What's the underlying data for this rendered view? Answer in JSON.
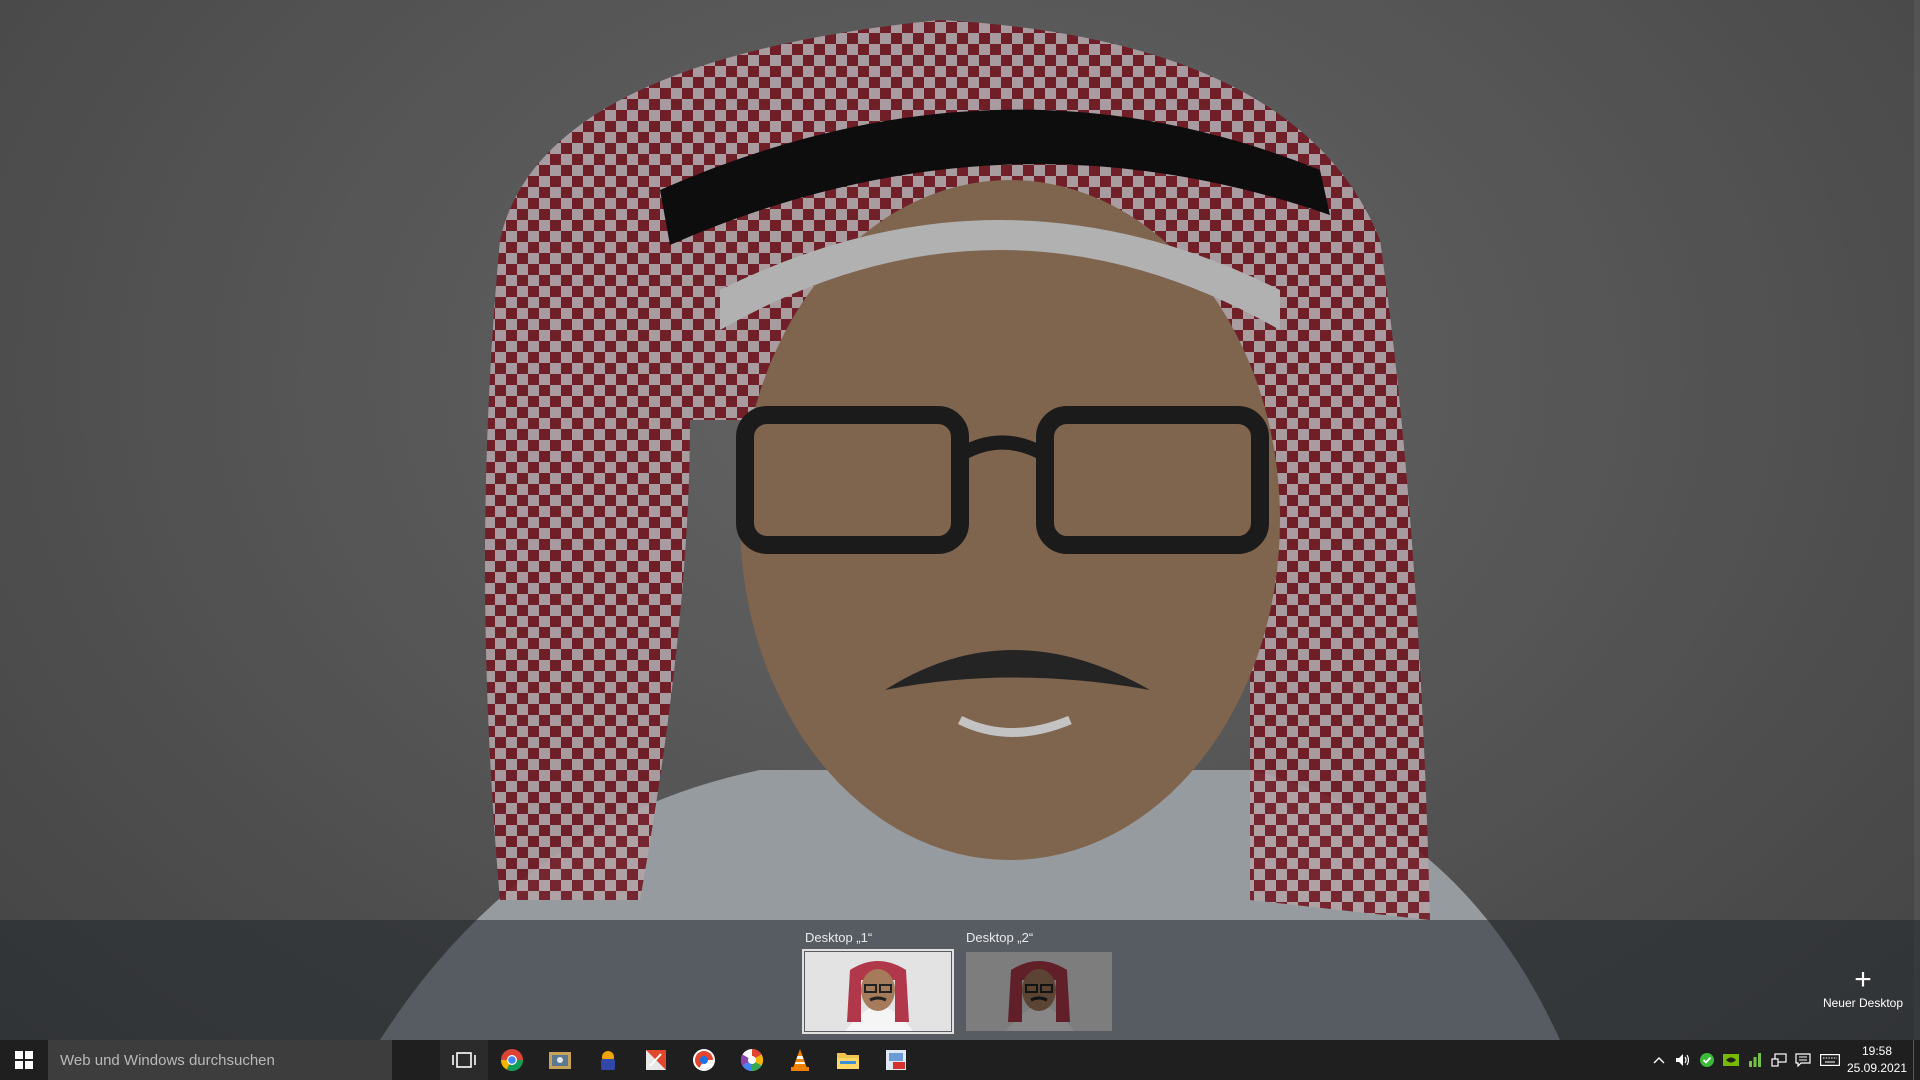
{
  "desktops": [
    {
      "label": "Desktop „1“",
      "active": true
    },
    {
      "label": "Desktop „2“",
      "active": false
    }
  ],
  "new_desktop": {
    "label": "Neuer Desktop",
    "icon": "plus-icon"
  },
  "taskbar": {
    "search_placeholder": "Web und Windows durchsuchen",
    "apps": [
      "task-view-icon",
      "chrome-icon",
      "photo-app-icon",
      "vpn-app-icon",
      "office-app-icon",
      "chrome-alt-icon",
      "picasa-icon",
      "vlc-icon",
      "file-explorer-icon",
      "pdf-app-icon"
    ],
    "tray": [
      "chevron-up-icon",
      "volume-icon",
      "security-check-icon",
      "nvidia-icon",
      "network-meter-icon",
      "network-icon",
      "action-center-icon",
      "keyboard-icon"
    ],
    "time": "19:58",
    "date": "25.09.2021"
  },
  "colors": {
    "taskbar": "#1f1f1f",
    "search_bg": "#3d3d3d",
    "accent": "#e0e0e0"
  }
}
